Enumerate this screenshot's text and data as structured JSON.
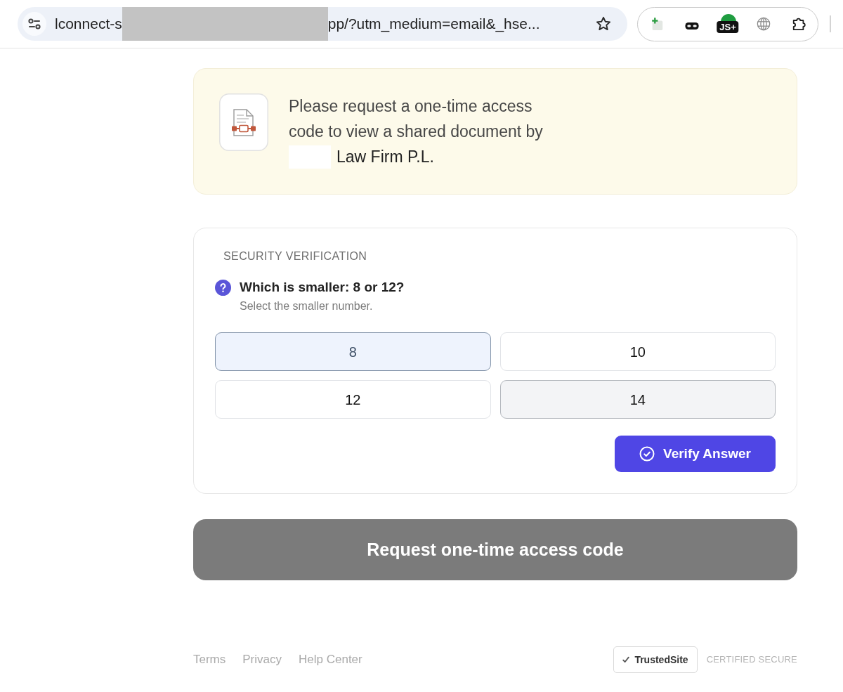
{
  "browser": {
    "url_parts": [
      "lconnect-s",
      "pp/?utm_medium=email&_hse..."
    ],
    "extension_badge": "JS+"
  },
  "notice": {
    "message": "Please request a one-time access code to view a shared document by",
    "firm_name": "Law Firm P.L."
  },
  "verification": {
    "heading": "SECURITY VERIFICATION",
    "question": "Which is smaller: 8 or 12?",
    "hint": "Select the smaller number.",
    "options": [
      {
        "label": "8",
        "selected": true,
        "hovered": false
      },
      {
        "label": "10",
        "selected": false,
        "hovered": false
      },
      {
        "label": "12",
        "selected": false,
        "hovered": false
      },
      {
        "label": "14",
        "selected": false,
        "hovered": true
      }
    ],
    "verify_button": "Verify Answer"
  },
  "request_button": {
    "label": "Request one-time access code",
    "disabled": true
  },
  "footer": {
    "links": [
      "Terms",
      "Privacy",
      "Help Center"
    ],
    "trust_badge": "TrustedSite",
    "certification": "CERTIFIED SECURE"
  }
}
